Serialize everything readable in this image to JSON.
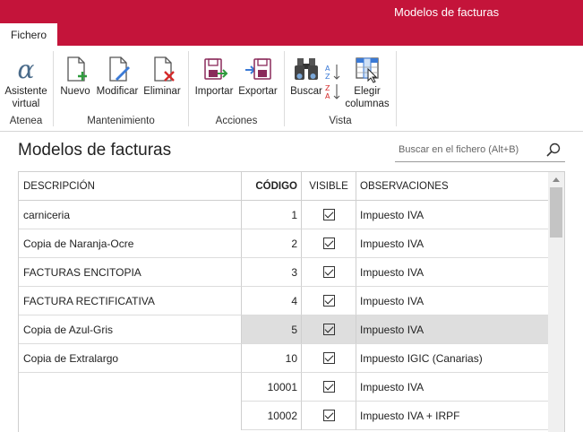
{
  "window": {
    "title": "Modelos de facturas"
  },
  "tabs": [
    {
      "label": "Fichero",
      "active": true
    }
  ],
  "ribbon": {
    "groups": [
      {
        "label": "Atenea",
        "buttons": [
          {
            "label": "Asistente virtual",
            "icon": "alpha-icon"
          }
        ]
      },
      {
        "label": "Mantenimiento",
        "buttons": [
          {
            "label": "Nuevo",
            "icon": "new-document-icon"
          },
          {
            "label": "Modificar",
            "icon": "edit-document-icon"
          },
          {
            "label": "Eliminar",
            "icon": "delete-document-icon"
          }
        ]
      },
      {
        "label": "Acciones",
        "buttons": [
          {
            "label": "Importar",
            "icon": "import-icon"
          },
          {
            "label": "Exportar",
            "icon": "export-icon"
          }
        ]
      },
      {
        "label": "Vista",
        "buttons": [
          {
            "label": "Buscar",
            "icon": "binoculars-icon"
          },
          {
            "label": "sort",
            "icon": "sort-icon"
          },
          {
            "label": "Elegir columnas",
            "icon": "columns-icon"
          }
        ]
      }
    ]
  },
  "main": {
    "title": "Modelos de facturas",
    "search": {
      "placeholder": "Buscar en el fichero (Alt+B)"
    }
  },
  "table": {
    "columns": [
      "DESCRIPCIÓN",
      "CÓDIGO",
      "VISIBLE",
      "OBSERVACIONES"
    ],
    "rows": [
      {
        "descripcion": "carniceria",
        "codigo": "1",
        "visible": true,
        "observaciones": "Impuesto IVA"
      },
      {
        "descripcion": "Copia de Naranja-Ocre",
        "codigo": "2",
        "visible": true,
        "observaciones": "Impuesto IVA"
      },
      {
        "descripcion": "FACTURAS ENCITOPIA",
        "codigo": "3",
        "visible": true,
        "observaciones": "Impuesto IVA"
      },
      {
        "descripcion": "FACTURA RECTIFICATIVA",
        "codigo": "4",
        "visible": true,
        "observaciones": "Impuesto IVA"
      },
      {
        "descripcion": "Copia de Azul-Gris",
        "codigo": "5",
        "visible": true,
        "observaciones": "Impuesto IVA",
        "selected": true
      },
      {
        "descripcion": "Copia de Extralargo",
        "codigo": "10",
        "visible": true,
        "observaciones": "Impuesto IGIC (Canarias)"
      },
      {
        "descripcion": "",
        "codigo": "10001",
        "visible": true,
        "observaciones": "Impuesto IVA"
      },
      {
        "descripcion": "",
        "codigo": "10002",
        "visible": true,
        "observaciones": "Impuesto IVA + IRPF"
      }
    ]
  },
  "colors": {
    "accent": "#c4143a",
    "selected_row": "#dedede"
  }
}
